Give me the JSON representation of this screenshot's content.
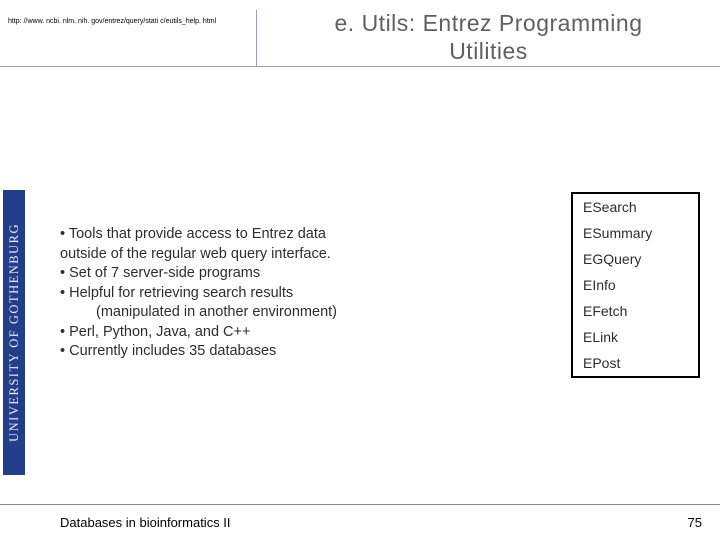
{
  "header": {
    "url": "http: //www. ncbi. nlm. nih. gov/entrez/query/stati c/eutils_help. html",
    "title_line1": "e. Utils: Entrez Programming",
    "title_line2": "Utilities"
  },
  "leftbar": {
    "label": "UNIVERSITY OF GOTHENBURG"
  },
  "content": {
    "b1a": " • Tools that provide access to Entrez data",
    "b1b": "outside of           the regular web query interface.",
    "b2": " • Set of 7 server-side programs",
    "b3": " • Helpful for retrieving search results",
    "b3sub": "(manipulated in another environment)",
    "b4": " • Perl, Python, Java, and C++",
    "b5": " • Currently includes 35 databases"
  },
  "table": {
    "rows": [
      "ESearch",
      "ESummary",
      "EGQuery",
      "EInfo",
      "EFetch",
      "ELink",
      "EPost"
    ]
  },
  "footer": {
    "title": "Databases in bioinformatics II",
    "page": "75"
  }
}
